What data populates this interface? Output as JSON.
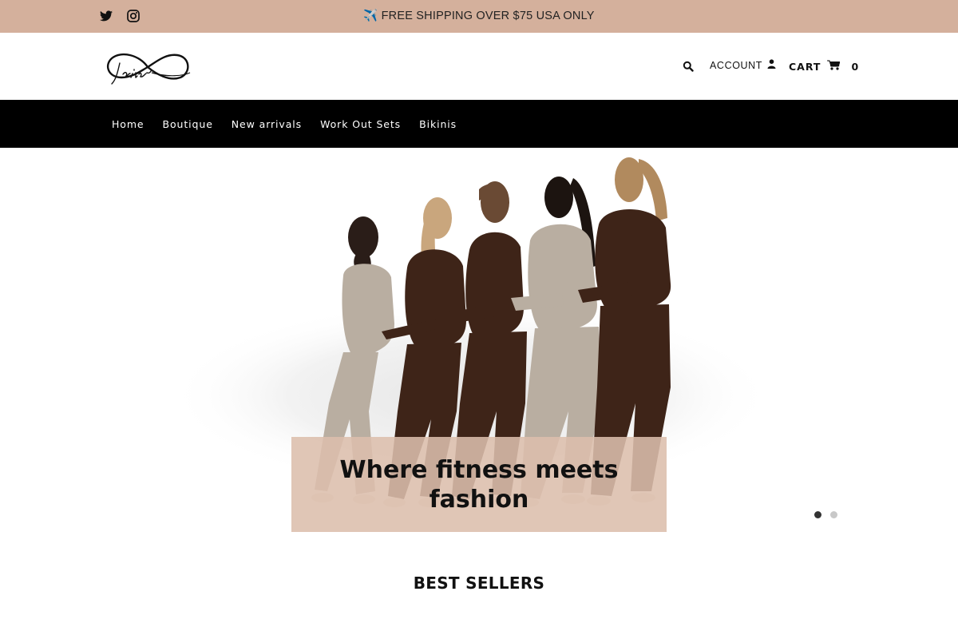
{
  "announcement": {
    "icon": "airplane-icon",
    "text": "FREE SHIPPING OVER $75 USA ONLY"
  },
  "social": [
    {
      "name": "twitter-icon"
    },
    {
      "name": "instagram-icon"
    }
  ],
  "header": {
    "logo_alt": "Jailyne",
    "account_label": "ACCOUNT",
    "cart_label": "CART",
    "cart_count": "0"
  },
  "nav": {
    "items": [
      "Home",
      "Boutique",
      "New arrivals",
      "Work Out Sets",
      "Bikinis"
    ]
  },
  "hero": {
    "caption": "Where fitness meets fashion",
    "slides": 2,
    "active_slide": 1
  },
  "best_sellers": {
    "title": "BEST SELLERS"
  },
  "colors": {
    "announcement_bg": "#d4b09c",
    "nav_bg": "#000000",
    "caption_bg": "#dcbeac",
    "brown_outfit": "#3e2418",
    "taupe_outfit": "#b9aea1"
  }
}
